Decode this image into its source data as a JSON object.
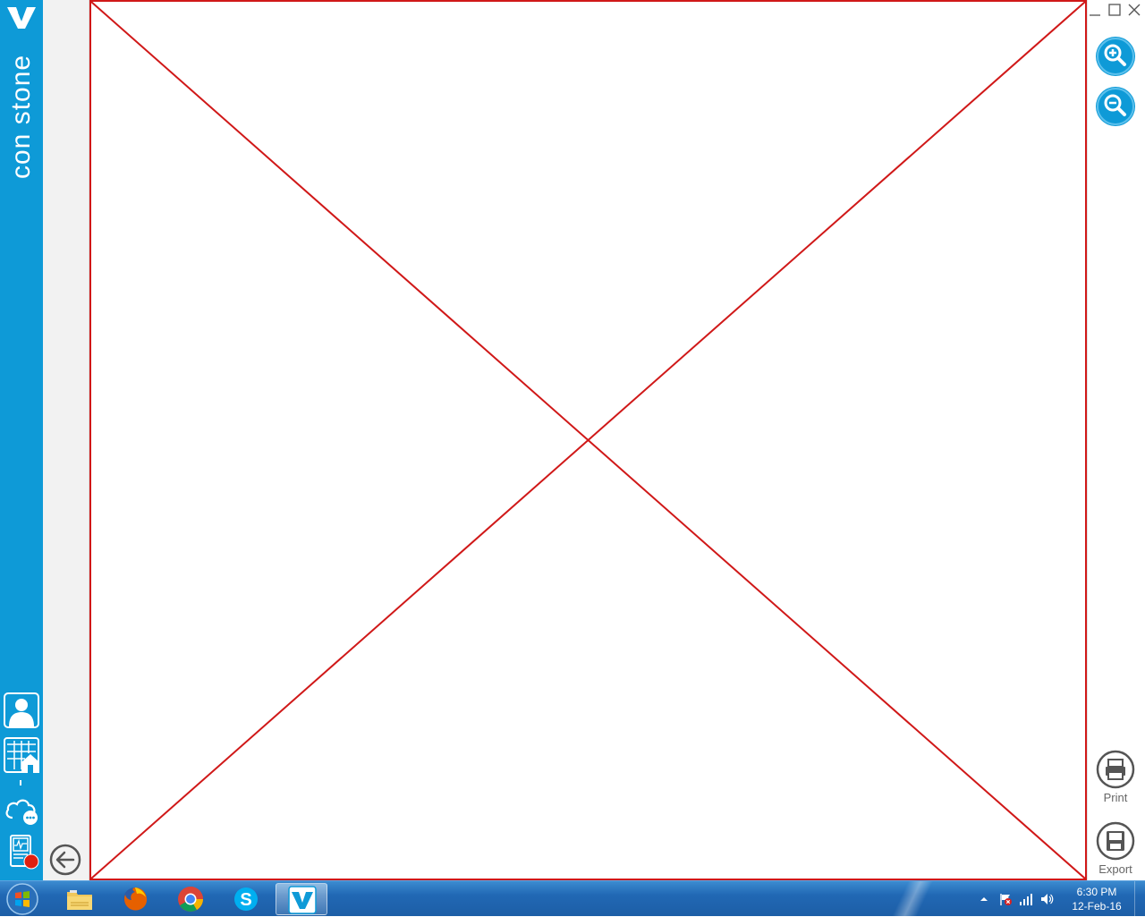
{
  "app": {
    "brand_name": "con stone",
    "logo": "v-logo",
    "accent_color": "#0e9ad7",
    "placeholder_border_color": "#d01818"
  },
  "sidebar": {
    "items": [
      {
        "icon": "person-icon"
      },
      {
        "icon": "building-icon"
      },
      {
        "icon": "cloud-chat-icon"
      },
      {
        "icon": "monitor-alert-icon",
        "badge_color": "#e02010"
      }
    ]
  },
  "window_controls": [
    "minimize-icon",
    "maximize-icon",
    "close-icon"
  ],
  "toolbar": {
    "zoom_in": "zoom-in-icon",
    "zoom_out": "zoom-out-icon",
    "print_label": "Print",
    "export_label": "Export"
  },
  "taskbar": {
    "apps": [
      "file-explorer",
      "firefox",
      "chrome",
      "skype",
      "vistage-app"
    ],
    "active_app": "vistage-app",
    "tray": [
      "show-hidden-icons",
      "action-center-flag",
      "network-signal",
      "volume"
    ],
    "time": "6:30 PM",
    "date": "12-Feb-16"
  }
}
